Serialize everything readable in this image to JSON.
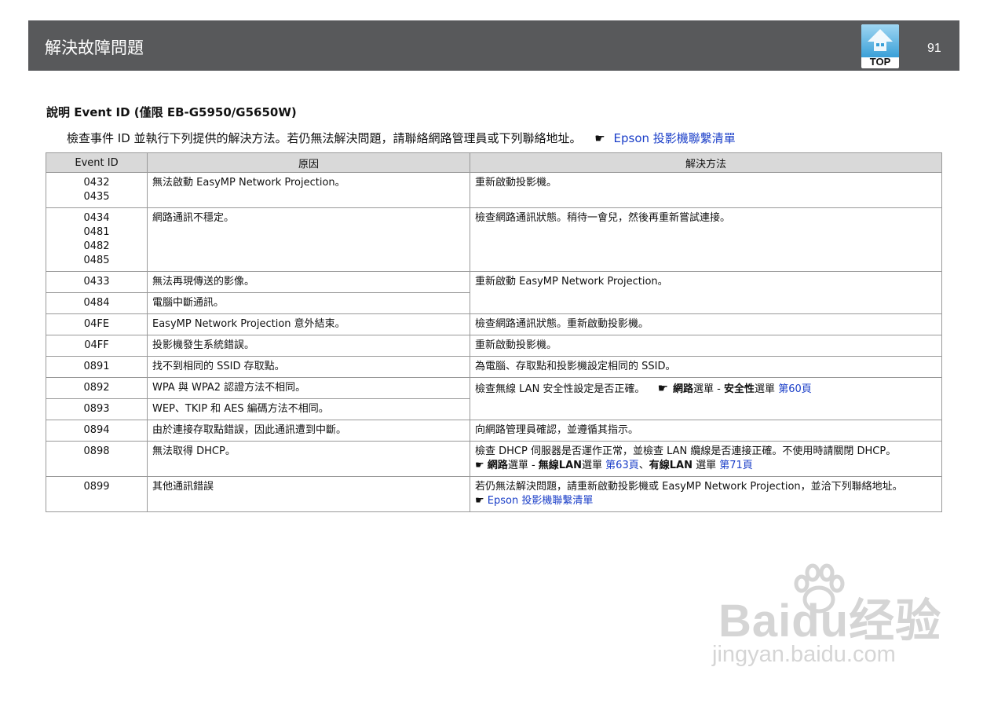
{
  "header": {
    "title": "解決故障問題",
    "page_number": "91",
    "top_label": "TOP"
  },
  "section": {
    "title": "說明 Event ID (僅限 EB-G5950/G5650W)",
    "description": "檢查事件 ID 並執行下列提供的解決方法。若仍無法解決問題，請聯絡網路管理員或下列聯絡地址。",
    "contact_link": "Epson 投影機聯繫清單"
  },
  "table": {
    "headers": [
      "Event ID",
      "原因",
      "解決方法"
    ],
    "rows": [
      {
        "ids": [
          "0432",
          "0435"
        ],
        "cause": "無法啟動 EasyMP Network Projection。",
        "solution": "重新啟動投影機。"
      },
      {
        "ids": [
          "0434",
          "0481",
          "0482",
          "0485"
        ],
        "cause": "網路通訊不穩定。",
        "solution": "檢查網路通訊狀態。稍待一會兒，然後再重新嘗試連接。"
      },
      {
        "ids": [
          "0433"
        ],
        "cause": "無法再現傳送的影像。",
        "solution": "重新啟動 EasyMP Network Projection。"
      },
      {
        "ids": [
          "0484"
        ],
        "cause": "電腦中斷通訊。"
      },
      {
        "ids": [
          "04FE"
        ],
        "cause": "EasyMP Network Projection 意外結束。",
        "solution": "檢查網路通訊狀態。重新啟動投影機。"
      },
      {
        "ids": [
          "04FF"
        ],
        "cause": "投影機發生系統錯誤。",
        "solution": "重新啟動投影機。"
      },
      {
        "ids": [
          "0891"
        ],
        "cause": "找不到相同的 SSID 存取點。",
        "solution": "為電腦、存取點和投影機設定相同的 SSID。"
      },
      {
        "ids": [
          "0892"
        ],
        "cause": "WPA 與 WPA2 認證方法不相同。",
        "solution_text": "檢查無線 LAN 安全性設定是否正確。",
        "solution_menu": "網路",
        "solution_sep": "選單 - ",
        "solution_menu2": "安全性",
        "solution_sep2": "選單",
        "solution_link": "第60頁"
      },
      {
        "ids": [
          "0893"
        ],
        "cause": "WEP、TKIP 和 AES 編碼方法不相同。"
      },
      {
        "ids": [
          "0894"
        ],
        "cause": "由於連接存取點錯誤，因此通訊遭到中斷。",
        "solution": "向網路管理員確認，並遵循其指示。"
      },
      {
        "ids": [
          "0898"
        ],
        "cause": "無法取得 DHCP。",
        "solution_line1": "檢查 DHCP 伺服器是否運作正常，並檢查 LAN 纜線是否連接正確。不使用時請關閉 DHCP。",
        "menu_a": "網路",
        "sep_a": "選單 - ",
        "menu_b": "無線LAN",
        "sep_b": "選單",
        "link_a": "第63頁",
        "sep_c": "、",
        "menu_c": "有線LAN",
        "sep_d": " 選單",
        "link_b": "第71頁"
      },
      {
        "ids": [
          "0899"
        ],
        "cause": "其他通訊錯誤",
        "solution_line1": "若仍無法解決問題，請重新啟動投影機或 EasyMP Network Projection，並洽下列聯絡地址。",
        "link": "Epson 投影機聯繫清單"
      }
    ]
  },
  "watermark": {
    "logo": "Baidu经验",
    "url": "jingyan.baidu.com"
  },
  "icons": {
    "pointer": "hand-pointer-icon",
    "top": "top-arrow-icon"
  }
}
